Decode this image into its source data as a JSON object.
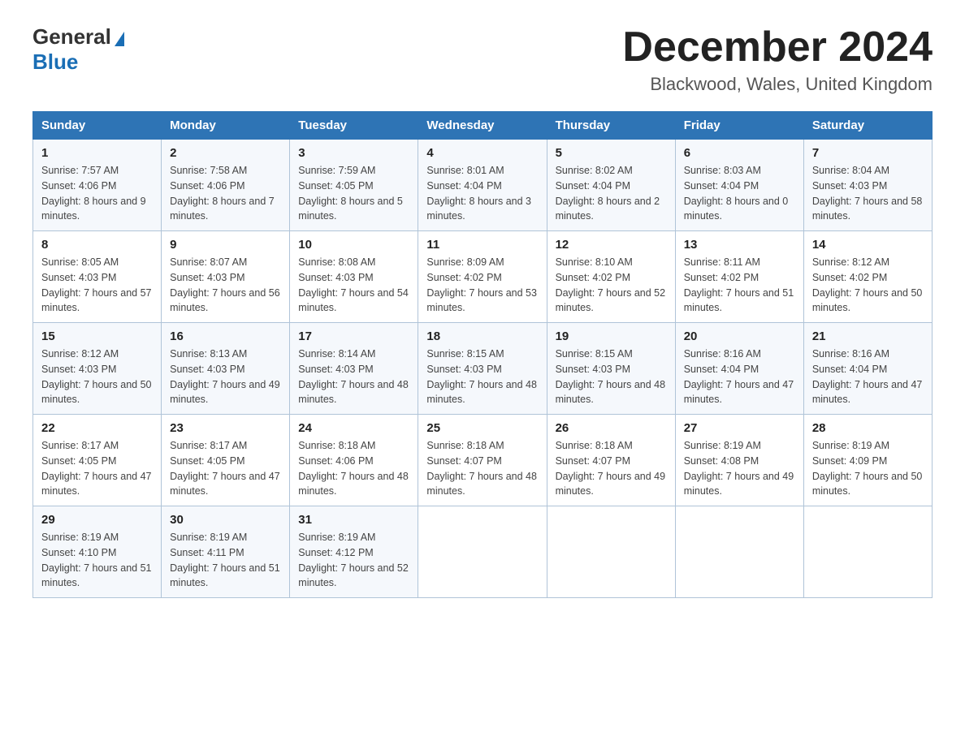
{
  "header": {
    "logo_general": "General",
    "logo_blue": "Blue",
    "title": "December 2024",
    "location": "Blackwood, Wales, United Kingdom"
  },
  "weekdays": [
    "Sunday",
    "Monday",
    "Tuesday",
    "Wednesday",
    "Thursday",
    "Friday",
    "Saturday"
  ],
  "weeks": [
    [
      {
        "day": "1",
        "sunrise": "7:57 AM",
        "sunset": "4:06 PM",
        "daylight": "8 hours and 9 minutes."
      },
      {
        "day": "2",
        "sunrise": "7:58 AM",
        "sunset": "4:06 PM",
        "daylight": "8 hours and 7 minutes."
      },
      {
        "day": "3",
        "sunrise": "7:59 AM",
        "sunset": "4:05 PM",
        "daylight": "8 hours and 5 minutes."
      },
      {
        "day": "4",
        "sunrise": "8:01 AM",
        "sunset": "4:04 PM",
        "daylight": "8 hours and 3 minutes."
      },
      {
        "day": "5",
        "sunrise": "8:02 AM",
        "sunset": "4:04 PM",
        "daylight": "8 hours and 2 minutes."
      },
      {
        "day": "6",
        "sunrise": "8:03 AM",
        "sunset": "4:04 PM",
        "daylight": "8 hours and 0 minutes."
      },
      {
        "day": "7",
        "sunrise": "8:04 AM",
        "sunset": "4:03 PM",
        "daylight": "7 hours and 58 minutes."
      }
    ],
    [
      {
        "day": "8",
        "sunrise": "8:05 AM",
        "sunset": "4:03 PM",
        "daylight": "7 hours and 57 minutes."
      },
      {
        "day": "9",
        "sunrise": "8:07 AM",
        "sunset": "4:03 PM",
        "daylight": "7 hours and 56 minutes."
      },
      {
        "day": "10",
        "sunrise": "8:08 AM",
        "sunset": "4:03 PM",
        "daylight": "7 hours and 54 minutes."
      },
      {
        "day": "11",
        "sunrise": "8:09 AM",
        "sunset": "4:02 PM",
        "daylight": "7 hours and 53 minutes."
      },
      {
        "day": "12",
        "sunrise": "8:10 AM",
        "sunset": "4:02 PM",
        "daylight": "7 hours and 52 minutes."
      },
      {
        "day": "13",
        "sunrise": "8:11 AM",
        "sunset": "4:02 PM",
        "daylight": "7 hours and 51 minutes."
      },
      {
        "day": "14",
        "sunrise": "8:12 AM",
        "sunset": "4:02 PM",
        "daylight": "7 hours and 50 minutes."
      }
    ],
    [
      {
        "day": "15",
        "sunrise": "8:12 AM",
        "sunset": "4:03 PM",
        "daylight": "7 hours and 50 minutes."
      },
      {
        "day": "16",
        "sunrise": "8:13 AM",
        "sunset": "4:03 PM",
        "daylight": "7 hours and 49 minutes."
      },
      {
        "day": "17",
        "sunrise": "8:14 AM",
        "sunset": "4:03 PM",
        "daylight": "7 hours and 48 minutes."
      },
      {
        "day": "18",
        "sunrise": "8:15 AM",
        "sunset": "4:03 PM",
        "daylight": "7 hours and 48 minutes."
      },
      {
        "day": "19",
        "sunrise": "8:15 AM",
        "sunset": "4:03 PM",
        "daylight": "7 hours and 48 minutes."
      },
      {
        "day": "20",
        "sunrise": "8:16 AM",
        "sunset": "4:04 PM",
        "daylight": "7 hours and 47 minutes."
      },
      {
        "day": "21",
        "sunrise": "8:16 AM",
        "sunset": "4:04 PM",
        "daylight": "7 hours and 47 minutes."
      }
    ],
    [
      {
        "day": "22",
        "sunrise": "8:17 AM",
        "sunset": "4:05 PM",
        "daylight": "7 hours and 47 minutes."
      },
      {
        "day": "23",
        "sunrise": "8:17 AM",
        "sunset": "4:05 PM",
        "daylight": "7 hours and 47 minutes."
      },
      {
        "day": "24",
        "sunrise": "8:18 AM",
        "sunset": "4:06 PM",
        "daylight": "7 hours and 48 minutes."
      },
      {
        "day": "25",
        "sunrise": "8:18 AM",
        "sunset": "4:07 PM",
        "daylight": "7 hours and 48 minutes."
      },
      {
        "day": "26",
        "sunrise": "8:18 AM",
        "sunset": "4:07 PM",
        "daylight": "7 hours and 49 minutes."
      },
      {
        "day": "27",
        "sunrise": "8:19 AM",
        "sunset": "4:08 PM",
        "daylight": "7 hours and 49 minutes."
      },
      {
        "day": "28",
        "sunrise": "8:19 AM",
        "sunset": "4:09 PM",
        "daylight": "7 hours and 50 minutes."
      }
    ],
    [
      {
        "day": "29",
        "sunrise": "8:19 AM",
        "sunset": "4:10 PM",
        "daylight": "7 hours and 51 minutes."
      },
      {
        "day": "30",
        "sunrise": "8:19 AM",
        "sunset": "4:11 PM",
        "daylight": "7 hours and 51 minutes."
      },
      {
        "day": "31",
        "sunrise": "8:19 AM",
        "sunset": "4:12 PM",
        "daylight": "7 hours and 52 minutes."
      },
      null,
      null,
      null,
      null
    ]
  ]
}
